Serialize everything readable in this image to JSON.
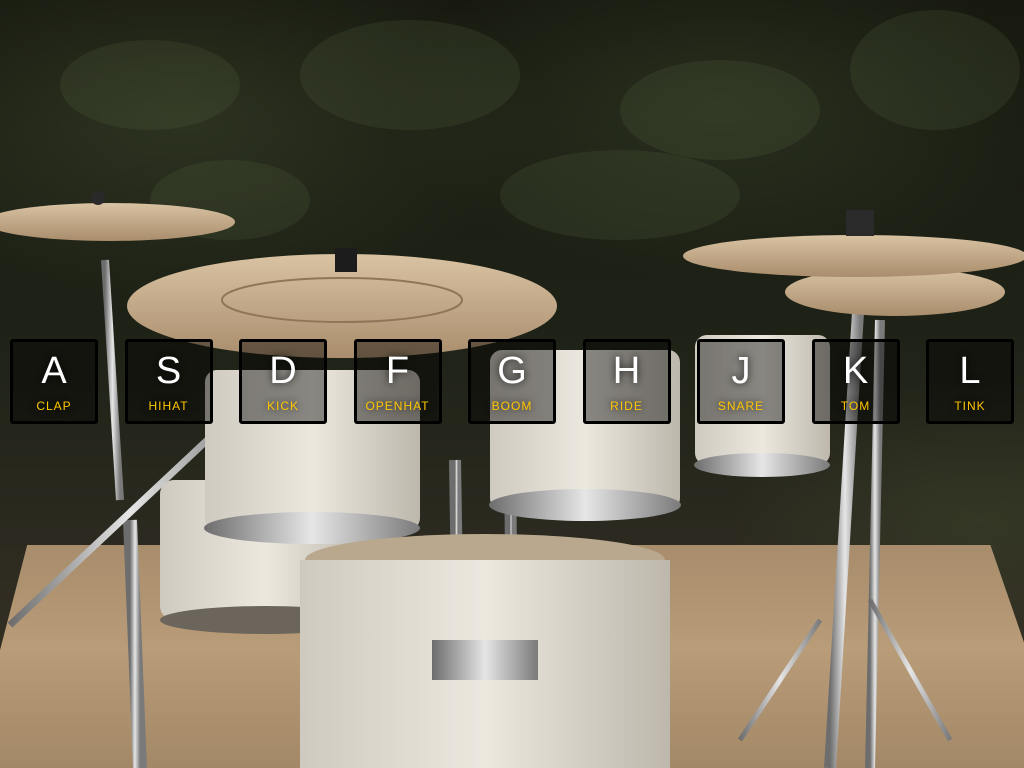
{
  "colors": {
    "accent": "#ffc600",
    "key_text": "#ffffff",
    "key_border": "#000000",
    "key_fill": "rgba(0,0,0,0.42)"
  },
  "background": {
    "subject": "drum kit on rug outdoors"
  },
  "keys": [
    {
      "key": "A",
      "sound": "clap"
    },
    {
      "key": "S",
      "sound": "hihat"
    },
    {
      "key": "D",
      "sound": "kick"
    },
    {
      "key": "F",
      "sound": "openhat"
    },
    {
      "key": "G",
      "sound": "boom"
    },
    {
      "key": "H",
      "sound": "ride"
    },
    {
      "key": "J",
      "sound": "snare"
    },
    {
      "key": "K",
      "sound": "tom"
    },
    {
      "key": "L",
      "sound": "tink"
    }
  ]
}
